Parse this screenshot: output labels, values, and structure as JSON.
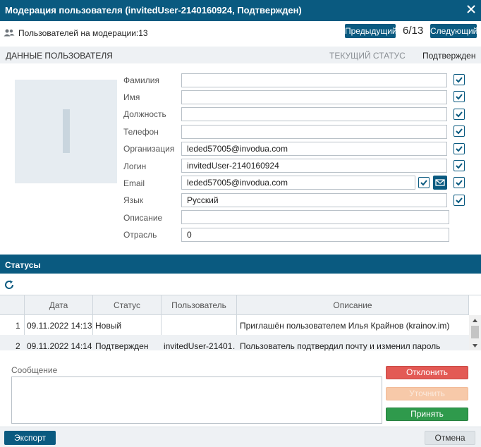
{
  "window": {
    "title": "Модерация пользователя (invitedUser-2140160924, Подтвержден)",
    "close_icon": "close-icon"
  },
  "topbar": {
    "moderation_label": "Пользователей на модерации:13",
    "prev_label": "Предыдущий",
    "counter": "6/13",
    "next_label": "Следующий"
  },
  "user_section": {
    "title": "ДАННЫЕ ПОЛЬЗОВАТЕЛЯ",
    "current_status_label": "ТЕКУЩИЙ СТАТУС",
    "current_status_value": "Подтвержден"
  },
  "fields": [
    {
      "label": "Фамилия",
      "value": ""
    },
    {
      "label": "Имя",
      "value": ""
    },
    {
      "label": "Должность",
      "value": ""
    },
    {
      "label": "Телефон",
      "value": ""
    },
    {
      "label": "Организация",
      "value": "leded57005@invodua.com"
    },
    {
      "label": "Логин",
      "value": "invitedUser-2140160924"
    },
    {
      "label": "Email",
      "value": "leded57005@invodua.com"
    },
    {
      "label": "Язык",
      "value": "Русский"
    },
    {
      "label": "Описание",
      "value": ""
    },
    {
      "label": "Отрасль",
      "value": "0"
    }
  ],
  "statuses": {
    "title": "Статусы",
    "columns": [
      "Дата",
      "Статус",
      "Пользователь",
      "Описание"
    ],
    "rows": [
      {
        "n": "1",
        "date": "09.11.2022 14:13",
        "status": "Новый",
        "user": "",
        "description": "Приглашён пользователем Илья Крайнов (krainov.im)"
      },
      {
        "n": "2",
        "date": "09.11.2022 14:14",
        "status": "Подтвержден",
        "user": "invitedUser-21401…",
        "description": "Пользователь подтвердил почту и изменил пароль"
      }
    ]
  },
  "message": {
    "label": "Сообщение",
    "value": ""
  },
  "actions": {
    "reject": "Отклонить",
    "clarify": "Уточнить",
    "accept": "Принять"
  },
  "footer": {
    "export": "Экспорт",
    "cancel": "Отмена"
  },
  "colors": {
    "primary": "#0a5a80",
    "reject": "#e35a55",
    "clarify": "#f7c9a9",
    "accept": "#2f9a4c"
  }
}
